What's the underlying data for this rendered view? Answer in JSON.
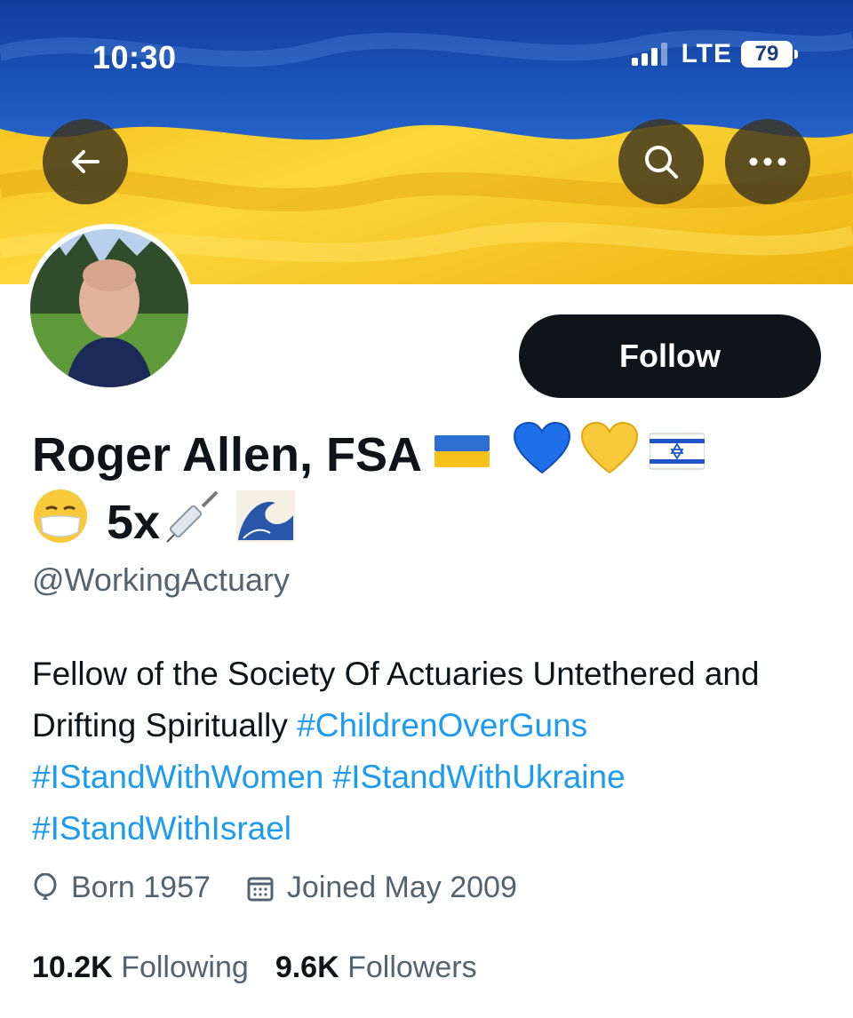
{
  "status_bar": {
    "time": "10:30",
    "network": "LTE",
    "battery": "79"
  },
  "banner": {
    "flag_top_color": "#1c56b8",
    "flag_bottom_color": "#f6c21a"
  },
  "header_buttons": {
    "back": "arrow-left-icon",
    "search": "search-icon",
    "more": "more-horizontal-icon"
  },
  "profile": {
    "name": "Roger Allen, FSA",
    "name_suffix": "5x",
    "handle": "@WorkingActuary",
    "follow_label": "Follow",
    "bio_text": "Fellow of the Society Of Actuaries Untethered and Drifting Spiritually",
    "hashtags": [
      "#ChildrenOverGuns",
      "#IStandWithWomen",
      "#IStandWithUkraine",
      "#IStandWithIsrael"
    ],
    "born": "Born 1957",
    "joined": "Joined May 2009",
    "following_count": "10.2K",
    "following_label": "Following",
    "followers_count": "9.6K",
    "followers_label": "Followers"
  },
  "colors": {
    "link": "#1d9bf0",
    "text": "#0f1419",
    "muted": "#536471"
  }
}
